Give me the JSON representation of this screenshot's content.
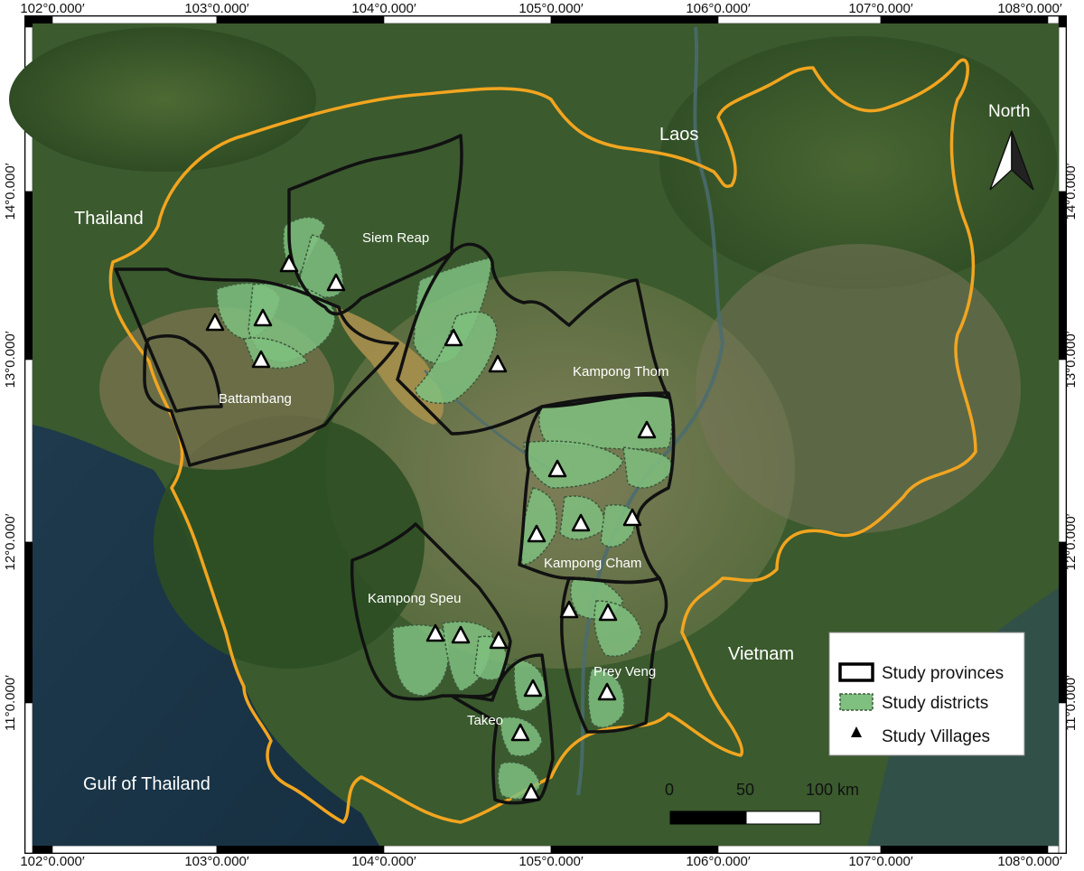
{
  "map": {
    "x_ticks": [
      "102°0.000′",
      "103°0.000′",
      "104°0.000′",
      "105°0.000′",
      "106°0.000′",
      "107°0.000′",
      "108°0.000′"
    ],
    "y_ticks": [
      "14°0.000′",
      "13°0.000′",
      "12°0.000′",
      "11°0.000′"
    ],
    "countries": {
      "thailand": "Thailand",
      "laos": "Laos",
      "vietnam": "Vietnam",
      "gulf": "Gulf of Thailand"
    },
    "provinces": {
      "siem_reap": "Siem Reap",
      "battambang": "Battambang",
      "kampong_thom": "Kampong Thom",
      "kampong_cham": "Kampong Cham",
      "kampong_speu": "Kampong Speu",
      "prey_veng": "Prey Veng",
      "takeo": "Takeo"
    },
    "north_label": "North",
    "scale_bar": {
      "labels": [
        "0",
        "50",
        "100 km"
      ]
    },
    "legend": {
      "provinces": "Study provinces",
      "districts": "Study districts",
      "villages": "Study Villages"
    },
    "colors": {
      "border": "#f2a51f",
      "province_line": "#111111",
      "district_fill": "#7fbf7f",
      "district_line": "#3d5a3d",
      "village_fill": "#ffffff"
    }
  }
}
